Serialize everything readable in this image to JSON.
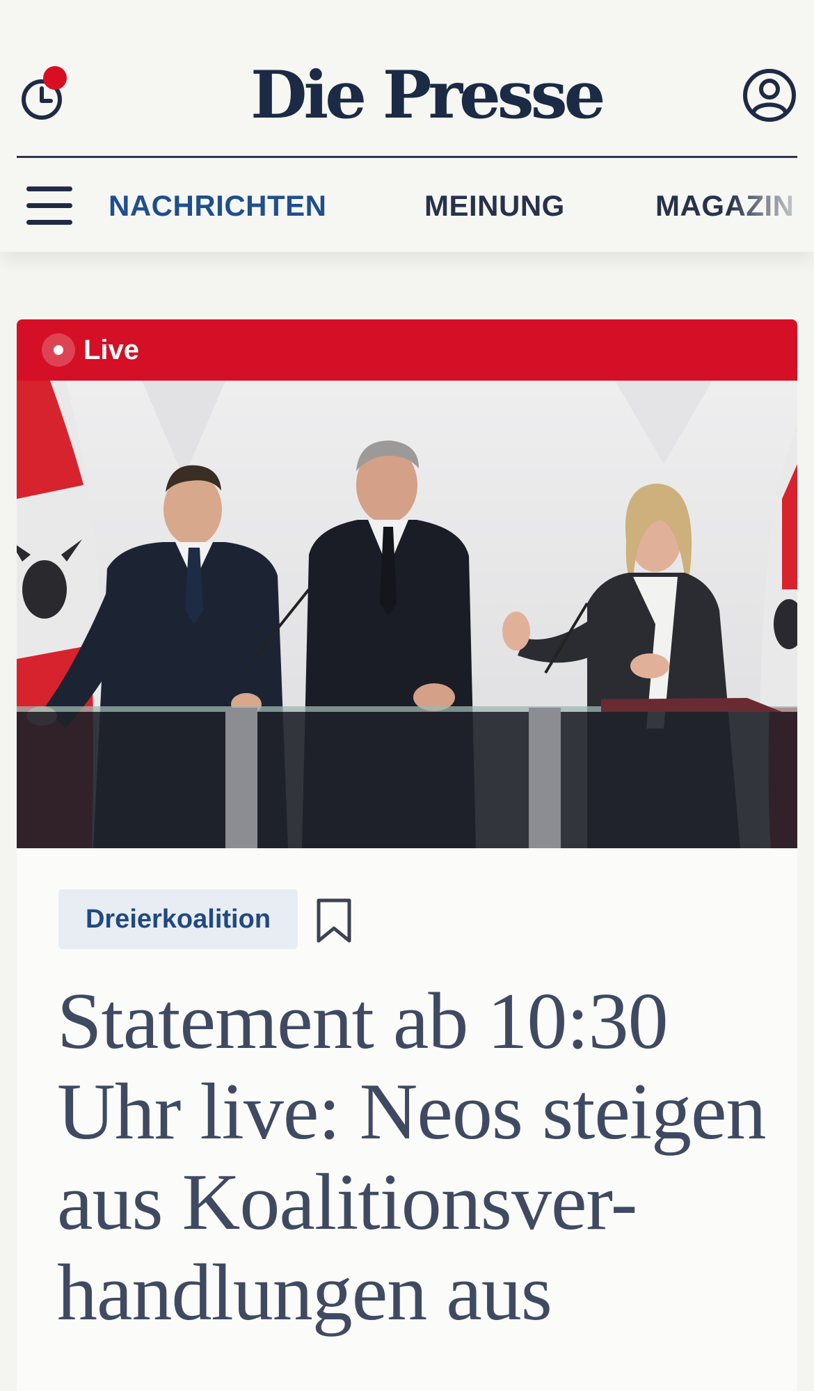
{
  "header": {
    "logo_text": "Die Presse",
    "history_icon": "clock-history-icon",
    "has_notification": true,
    "account_icon": "user-account-icon",
    "menu_icon": "hamburger-menu-icon"
  },
  "nav": {
    "items": [
      {
        "label": "NACHRICHTEN",
        "active": true
      },
      {
        "label": "MEINUNG",
        "active": false
      },
      {
        "label": "MAGAZIN",
        "active": false
      }
    ]
  },
  "article": {
    "live_label": "Live",
    "tag": "Dreierkoalition",
    "bookmark_icon": "bookmark-icon",
    "headline": "Statement ab 10:30\nUhr live: Neos steigen\naus Koalitionsver-\nhandlungen aus"
  },
  "colors": {
    "brand_navy": "#1b2a45",
    "live_red": "#d50f25",
    "active_nav": "#1f4f8c",
    "headline": "#3f4a62",
    "tag_bg": "#e8edf3"
  }
}
